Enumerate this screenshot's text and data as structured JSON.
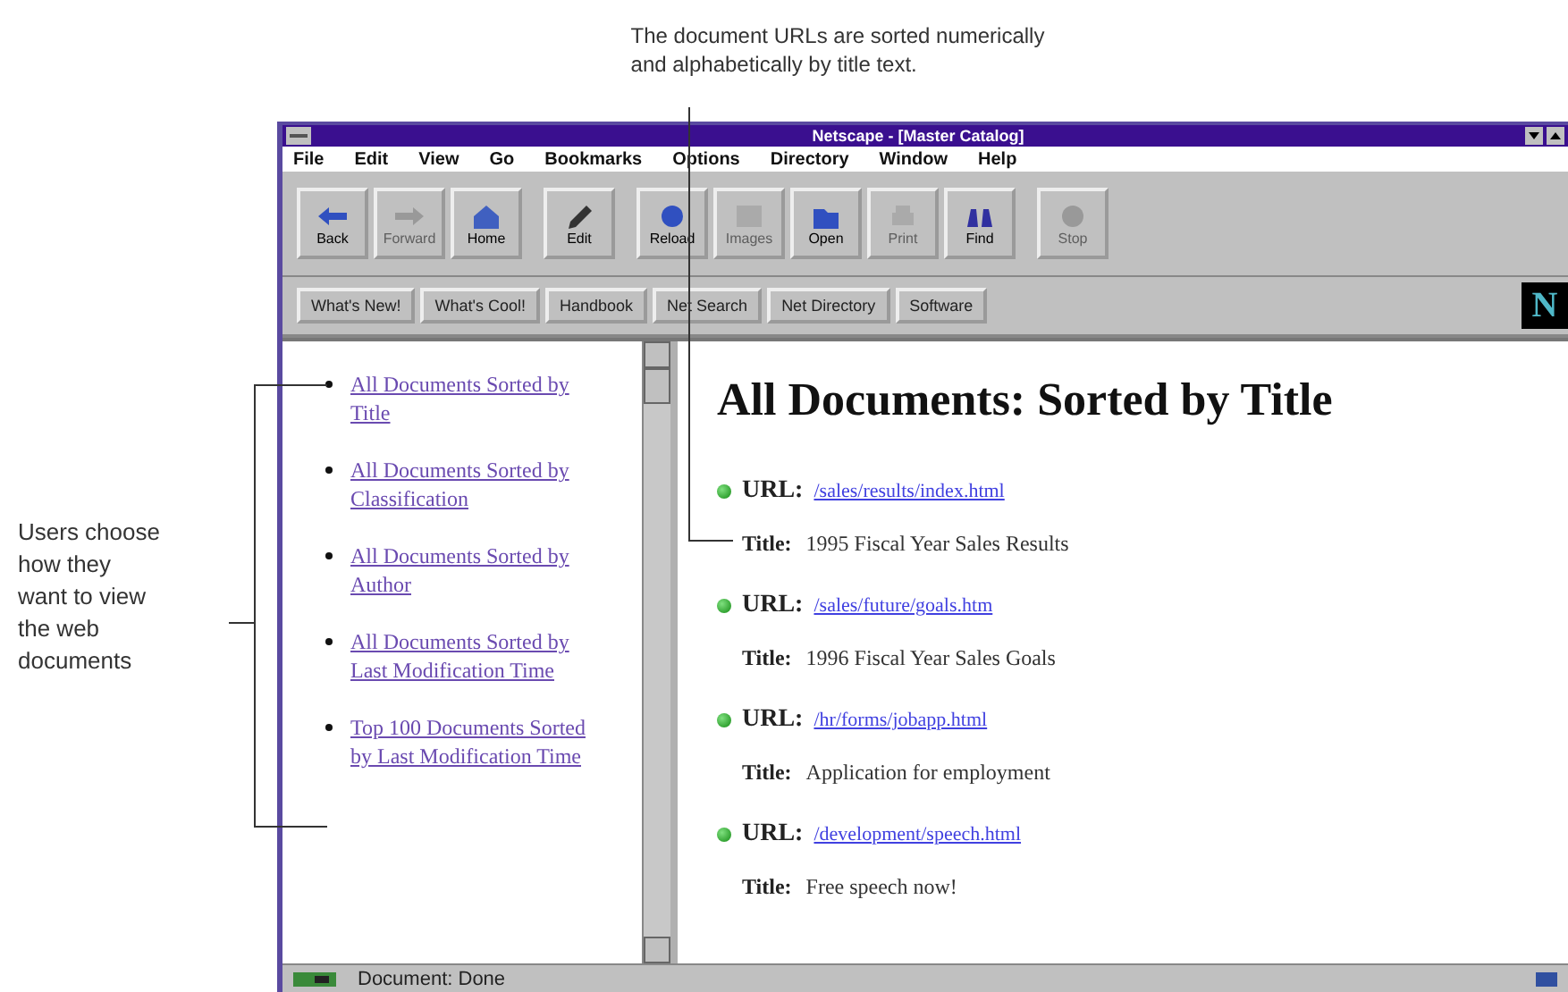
{
  "annotations": {
    "top": [
      "The document URLs are sorted numerically",
      "and alphabetically by title text."
    ],
    "left": [
      "Users choose",
      "how they",
      "want to view",
      "the web",
      "documents"
    ]
  },
  "window": {
    "title": "Netscape - [Master Catalog]"
  },
  "menu": [
    "File",
    "Edit",
    "View",
    "Go",
    "Bookmarks",
    "Options",
    "Directory",
    "Window",
    "Help"
  ],
  "toolbar_groups": [
    {
      "buttons": [
        {
          "label": "Back",
          "kind": "back",
          "disabled": false
        },
        {
          "label": "Forward",
          "kind": "forward",
          "disabled": true
        },
        {
          "label": "Home",
          "kind": "home",
          "disabled": false
        }
      ]
    },
    {
      "buttons": [
        {
          "label": "Edit",
          "kind": "edit",
          "disabled": false
        }
      ]
    },
    {
      "buttons": [
        {
          "label": "Reload",
          "kind": "reload",
          "disabled": false
        },
        {
          "label": "Images",
          "kind": "images",
          "disabled": true
        },
        {
          "label": "Open",
          "kind": "open",
          "disabled": false
        },
        {
          "label": "Print",
          "kind": "print",
          "disabled": true
        },
        {
          "label": "Find",
          "kind": "find",
          "disabled": false
        }
      ]
    },
    {
      "buttons": [
        {
          "label": "Stop",
          "kind": "stop",
          "disabled": true
        }
      ]
    }
  ],
  "link_bar": [
    "What's New!",
    "What's Cool!",
    "Handbook",
    "Net Search",
    "Net Directory",
    "Software"
  ],
  "logo": "N",
  "left_frame": {
    "links": [
      "All Documents Sorted by Title",
      "All Documents Sorted by Classification",
      "All Documents Sorted by Author",
      "All Documents Sorted by Last Modification Time",
      "Top 100 Documents Sorted by Last Modification Time"
    ]
  },
  "main": {
    "heading": "All Documents: Sorted by Title",
    "entries": [
      {
        "url_label": "URL:",
        "url": "/sales/results/index.html",
        "title_label": "Title:",
        "title": "1995 Fiscal Year Sales Results"
      },
      {
        "url_label": "URL:",
        "url": "/sales/future/goals.htm",
        "title_label": "Title:",
        "title": "1996 Fiscal Year Sales Goals"
      },
      {
        "url_label": "URL:",
        "url": "/hr/forms/jobapp.html",
        "title_label": "Title:",
        "title": "Application for employment"
      },
      {
        "url_label": "URL:",
        "url": "/development/speech.html",
        "title_label": "Title:",
        "title": "Free speech now!"
      }
    ]
  },
  "status_bar": {
    "text": "Document: Done"
  }
}
